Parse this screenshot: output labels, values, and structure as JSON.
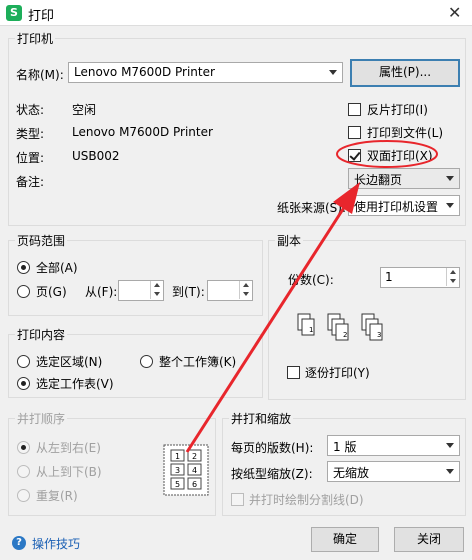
{
  "window": {
    "title": "打印",
    "app_icon": "S"
  },
  "printer": {
    "legend": "打印机",
    "name_label": "名称(M):",
    "name_value": "Lenovo M7600D Printer",
    "properties_button": "属性(P)...",
    "status_label": "状态:",
    "status_value": "空闲",
    "type_label": "类型:",
    "type_value": "Lenovo M7600D Printer",
    "location_label": "位置:",
    "location_value": "USB002",
    "comment_label": "备注:",
    "reverse_print": "反片打印(I)",
    "print_to_file": "打印到文件(L)",
    "duplex": "双面打印(X)",
    "duplex_mode": "长边翻页",
    "paper_source_label": "纸张来源(S):",
    "paper_source_value": "使用打印机设置"
  },
  "page_range": {
    "legend": "页码范围",
    "all": "全部(A)",
    "pages": "页(G)",
    "from_label": "从(F):",
    "to_label": "到(T):",
    "from_value": "",
    "to_value": ""
  },
  "copies": {
    "legend": "副本",
    "count_label": "份数(C):",
    "count_value": "1",
    "collate": "逐份打印(Y)"
  },
  "print_content": {
    "legend": "打印内容",
    "selection": "选定区域(N)",
    "workbook": "整个工作簿(K)",
    "sheet": "选定工作表(V)"
  },
  "order": {
    "legend": "并打顺序",
    "ltr": "从左到右(E)",
    "ttb": "从上到下(B)",
    "repeat": "重复(R)",
    "preview_numbers": [
      "1",
      "2",
      "3",
      "4",
      "5",
      "6"
    ]
  },
  "scale": {
    "legend": "并打和缩放",
    "pages_per_sheet_label": "每页的版数(H):",
    "pages_per_sheet_value": "1 版",
    "paper_scale_label": "按纸型缩放(Z):",
    "paper_scale_value": "无缩放",
    "draw_borders": "并打时绘制分割线(D)"
  },
  "footer": {
    "help_icon": "?",
    "help_link": "操作技巧",
    "ok": "确定",
    "close": "关闭"
  },
  "collate_pages": [
    "1",
    "2",
    "3"
  ],
  "colors": {
    "annotation": "#e8262c",
    "link": "#1a5fb4",
    "app_green": "#1dae5a"
  }
}
